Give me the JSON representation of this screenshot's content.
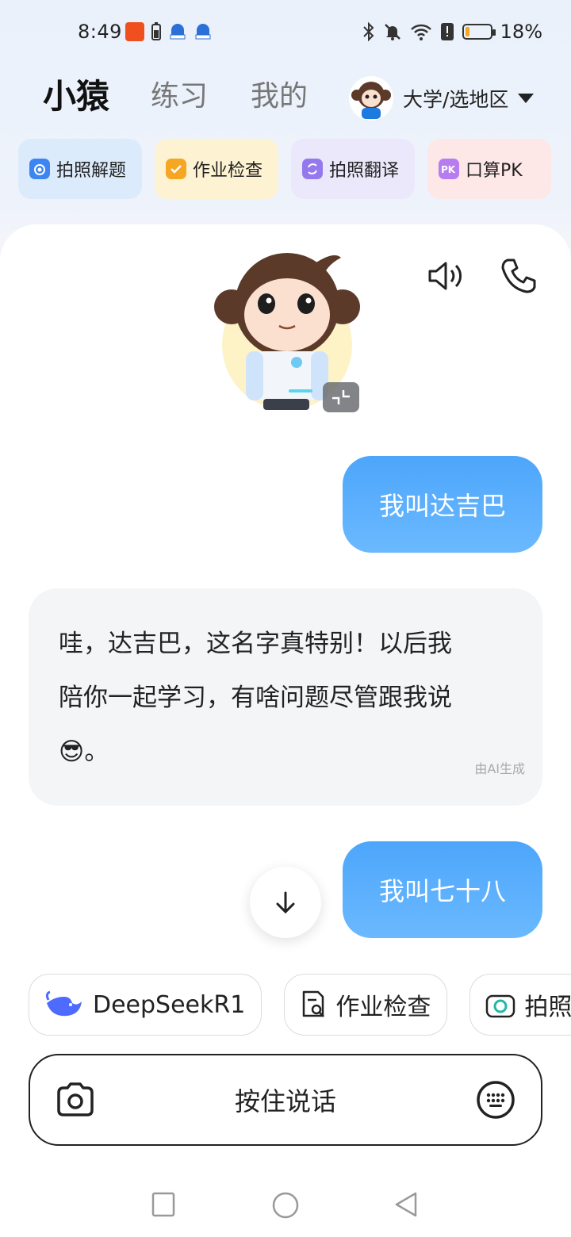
{
  "status": {
    "time": "8:49",
    "battery_pct": "18%",
    "battery_level": 0.18
  },
  "header": {
    "tabs": [
      {
        "label": "小猿",
        "active": true
      },
      {
        "label": "练习",
        "active": false
      },
      {
        "label": "我的",
        "active": false
      }
    ],
    "region_label": "大学/选地区"
  },
  "quick_tools": [
    {
      "label": "拍照解题",
      "icon": "camera-icon",
      "bg": "#dcebfb",
      "icon_color": "#3d86f2"
    },
    {
      "label": "作业检查",
      "icon": "check-bag-icon",
      "bg": "#fdf2d2",
      "icon_color": "#f5a623"
    },
    {
      "label": "拍照翻译",
      "icon": "translate-icon",
      "bg": "#ece8fb",
      "icon_color": "#9479ec"
    },
    {
      "label": "口算PK",
      "icon": "pk-icon",
      "bg": "#fde7e7",
      "icon_color": "#b77cf0"
    }
  ],
  "chat": {
    "messages": [
      {
        "role": "user",
        "text": "我叫达吉巴"
      },
      {
        "role": "ai",
        "lines": [
          "哇，达吉巴，这名字真特别！以后我",
          "陪你一起学习，有啥问题尽管跟我说",
          "😎。"
        ],
        "tag": "由AI生成"
      },
      {
        "role": "user",
        "text": "我叫七十八"
      }
    ]
  },
  "chips": [
    {
      "label": "DeepSeekR1",
      "icon": "deepseek-whale-icon"
    },
    {
      "label": "作业检查",
      "icon": "document-search-icon"
    },
    {
      "label": "拍照",
      "icon": "camera-icon"
    }
  ],
  "input": {
    "voice_label": "按住说话"
  },
  "colors": {
    "accent_blue": "#4da6fb",
    "bubble_ai_bg": "#f4f5f7"
  }
}
